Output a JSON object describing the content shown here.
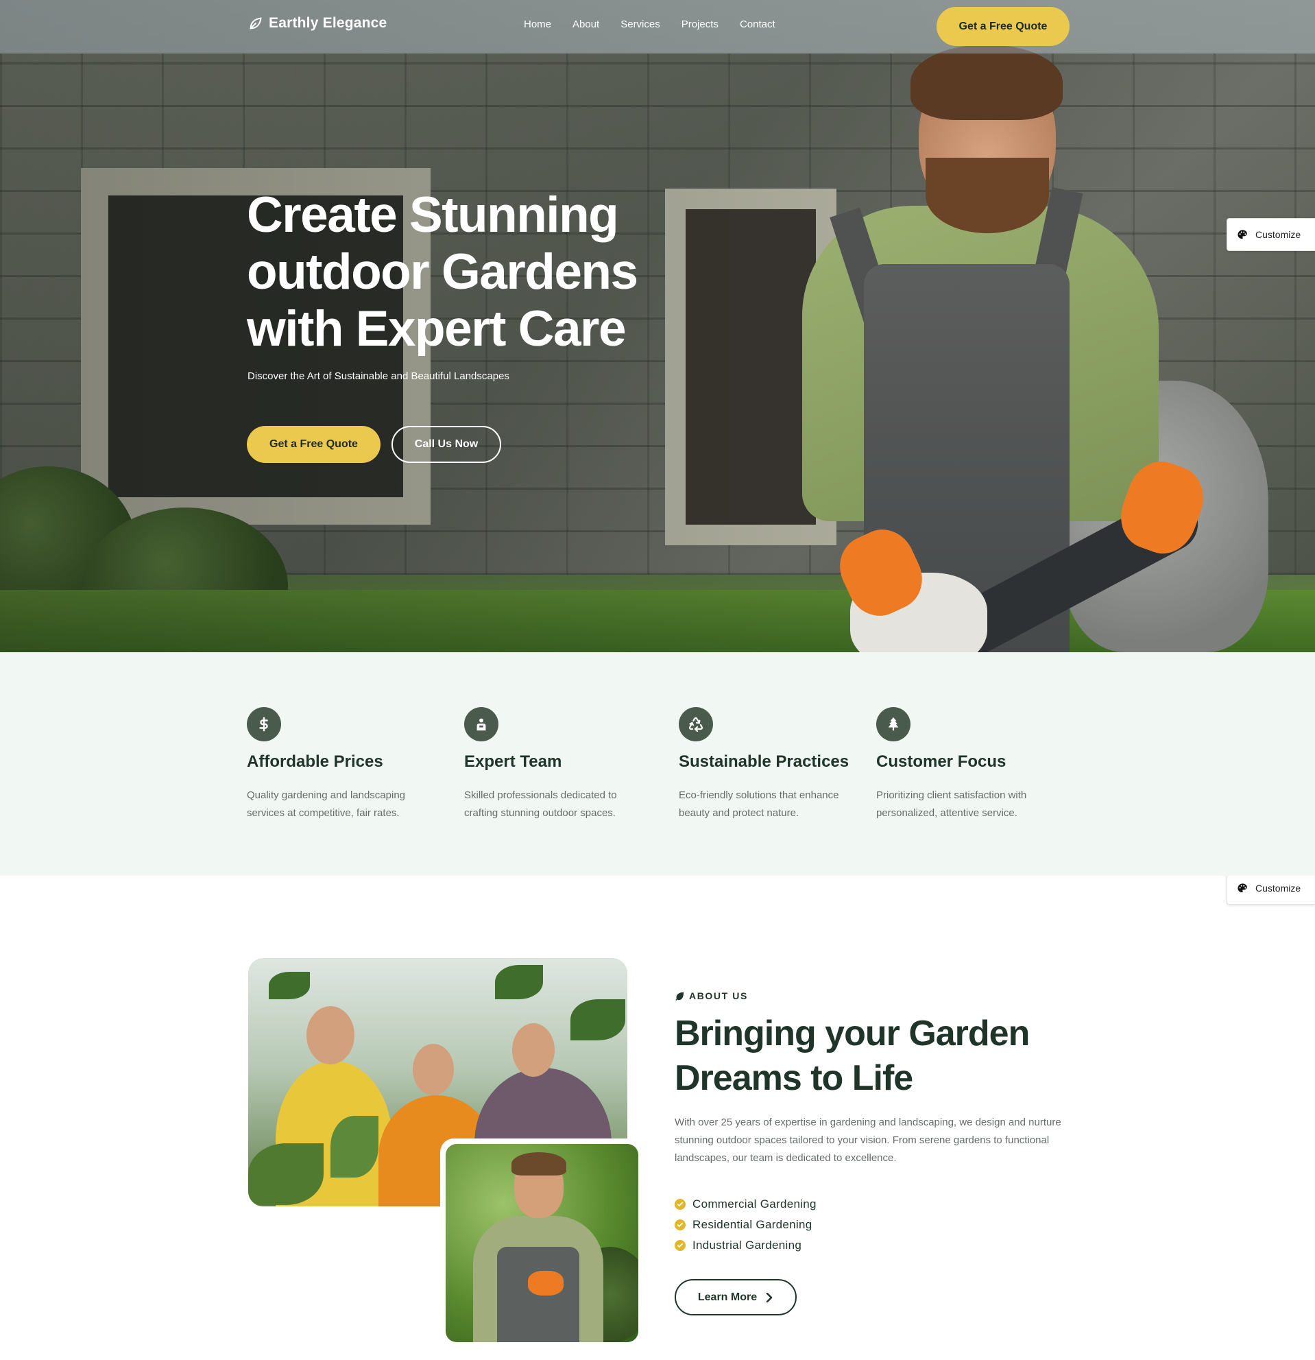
{
  "brand": {
    "name": "Earthly Elegance",
    "icon": "leaf-outline-icon"
  },
  "nav": {
    "items": [
      {
        "label": "Home"
      },
      {
        "label": "About"
      },
      {
        "label": "Services"
      },
      {
        "label": "Projects"
      },
      {
        "label": "Contact"
      }
    ],
    "cta_label": "Get a Free Quote"
  },
  "hero": {
    "title": "Create Stunning outdoor Gardens with Expert Care",
    "subtitle": "Discover the Art of Sustainable and Beautiful Landscapes",
    "primary_label": "Get a Free Quote",
    "secondary_label": "Call Us Now"
  },
  "customize": {
    "label": "Customize",
    "icon": "palette-icon"
  },
  "features": [
    {
      "icon": "dollar-icon",
      "title": "Affordable Prices",
      "desc": "Quality gardening and landscaping services at competitive, fair rates."
    },
    {
      "icon": "team-icon",
      "title": "Expert Team",
      "desc": "Skilled professionals dedicated to crafting stunning outdoor spaces."
    },
    {
      "icon": "recycle-icon",
      "title": "Sustainable Practices",
      "desc": "Eco-friendly solutions that enhance beauty and protect nature."
    },
    {
      "icon": "tree-icon",
      "title": "Customer Focus",
      "desc": "Prioritizing client satisfaction with personalized, attentive service."
    }
  ],
  "about": {
    "eyebrow": "ABOUT US",
    "title": "Bringing your Garden Dreams to Life",
    "text": "With over 25 years of expertise in gardening and landscaping, we design and nurture stunning outdoor spaces tailored to your vision. From serene gardens to functional landscapes, our team is dedicated to excellence.",
    "list": [
      {
        "label": "Commercial Gardening"
      },
      {
        "label": "Residential Gardening"
      },
      {
        "label": "Industrial Gardening"
      }
    ],
    "button_label": "Learn More"
  },
  "colors": {
    "accent": "#ebc94e",
    "dark_green": "#1f3529",
    "icon_bg": "#4a5a4c",
    "features_bg": "#f1f7f3",
    "check": "#e2b628"
  }
}
